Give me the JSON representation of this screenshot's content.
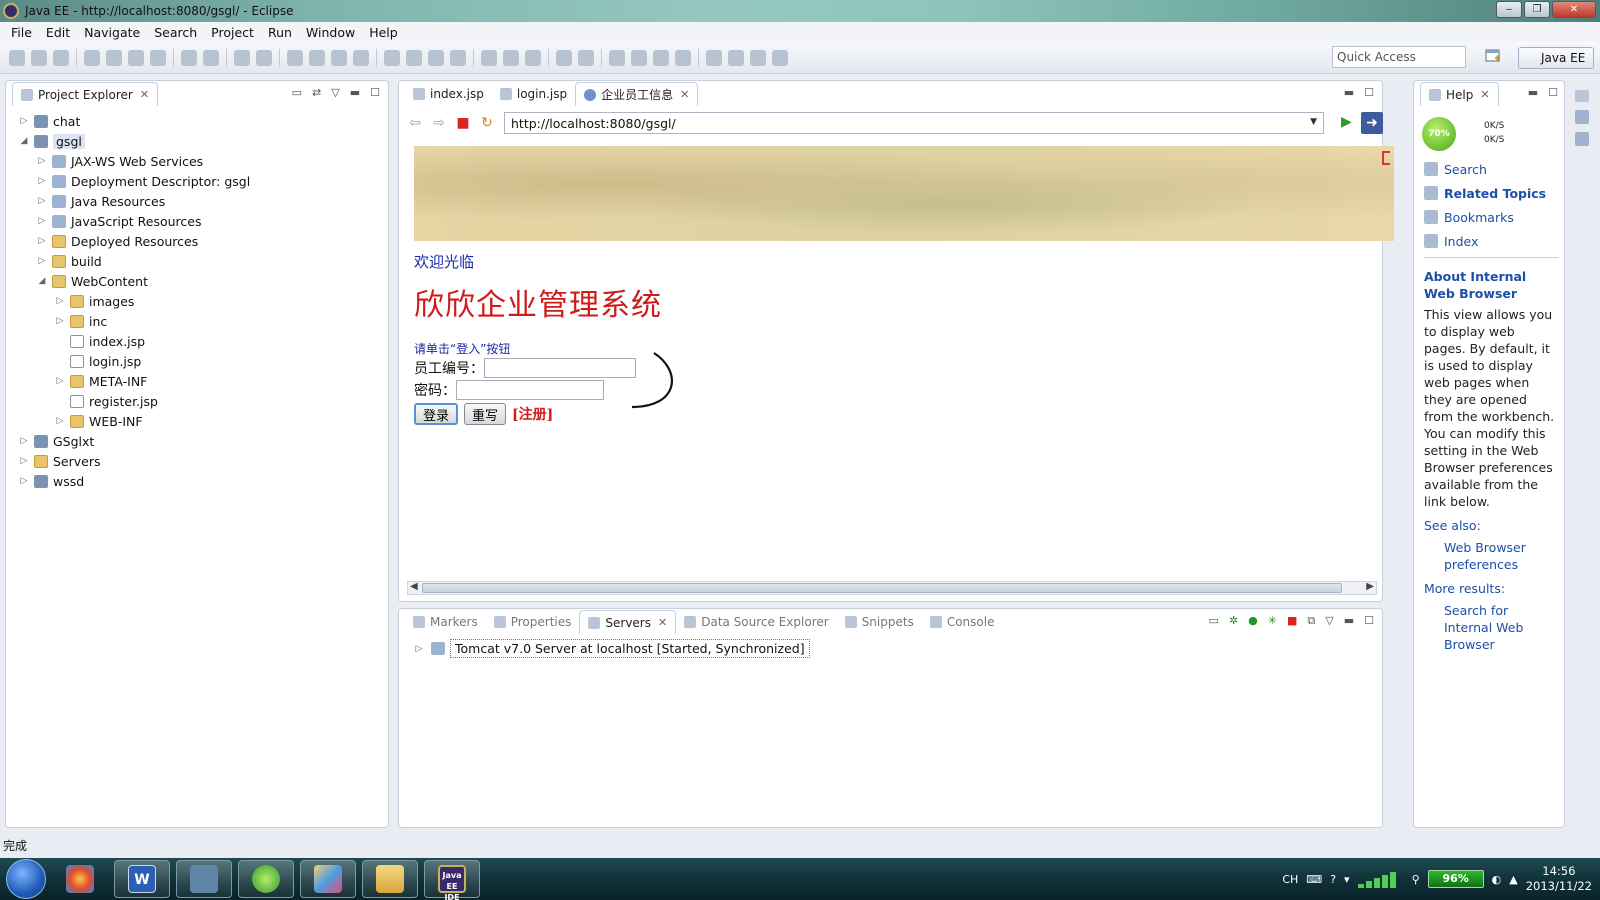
{
  "window": {
    "title": "Java EE - http://localhost:8080/gsgl/ - Eclipse",
    "minimize": "‒",
    "restore": "❐",
    "close": "✕"
  },
  "menu": [
    "File",
    "Edit",
    "Navigate",
    "Search",
    "Project",
    "Run",
    "Window",
    "Help"
  ],
  "toolbar": {
    "quick_access_placeholder": "Quick Access",
    "perspective": "Java EE"
  },
  "project_explorer": {
    "title": "Project Explorer",
    "items": [
      {
        "label": "chat",
        "level": 0,
        "expanded": false,
        "icon": "project-icon"
      },
      {
        "label": "gsgl",
        "level": 0,
        "expanded": true,
        "icon": "project-icon",
        "selected": true
      },
      {
        "label": "JAX-WS Web Services",
        "level": 1,
        "expanded": false,
        "icon": "webservice-icon"
      },
      {
        "label": "Deployment Descriptor: gsgl",
        "level": 1,
        "expanded": false,
        "icon": "descriptor-icon"
      },
      {
        "label": "Java Resources",
        "level": 1,
        "expanded": false,
        "icon": "java-resources-icon"
      },
      {
        "label": "JavaScript Resources",
        "level": 1,
        "expanded": false,
        "icon": "javascript-resources-icon"
      },
      {
        "label": "Deployed Resources",
        "level": 1,
        "expanded": false,
        "icon": "folder-icon"
      },
      {
        "label": "build",
        "level": 1,
        "expanded": false,
        "icon": "folder-icon"
      },
      {
        "label": "WebContent",
        "level": 1,
        "expanded": true,
        "icon": "folder-icon"
      },
      {
        "label": "images",
        "level": 2,
        "expanded": false,
        "icon": "folder-icon"
      },
      {
        "label": "inc",
        "level": 2,
        "expanded": false,
        "icon": "folder-icon"
      },
      {
        "label": "index.jsp",
        "level": 2,
        "leaf": true,
        "icon": "jsp-file-icon"
      },
      {
        "label": "login.jsp",
        "level": 2,
        "leaf": true,
        "icon": "jsp-file-icon"
      },
      {
        "label": "META-INF",
        "level": 2,
        "expanded": false,
        "icon": "folder-icon"
      },
      {
        "label": "register.jsp",
        "level": 2,
        "leaf": true,
        "icon": "jsp-file-icon"
      },
      {
        "label": "WEB-INF",
        "level": 2,
        "expanded": false,
        "icon": "folder-icon"
      },
      {
        "label": "GSglxt",
        "level": 0,
        "expanded": false,
        "icon": "project-icon"
      },
      {
        "label": "Servers",
        "level": 0,
        "expanded": false,
        "icon": "folder-icon"
      },
      {
        "label": "wssd",
        "level": 0,
        "expanded": false,
        "icon": "project-icon"
      }
    ]
  },
  "editor": {
    "tabs": [
      {
        "label": "index.jsp",
        "active": false
      },
      {
        "label": "login.jsp",
        "active": false
      },
      {
        "label": "企业员工信息",
        "active": true
      }
    ],
    "url": "http://localhost:8080/gsgl/",
    "page": {
      "welcome": "欢迎光临",
      "title": "欣欣企业管理系统",
      "hint": "请单击“登入”按钮",
      "employee_id_label": "员工编号：",
      "password_label": "密码：",
      "login_button": "登录",
      "reset_button": "重写",
      "register_link": "[注册]"
    }
  },
  "servers_view": {
    "tabs": [
      {
        "label": "Markers",
        "active": false
      },
      {
        "label": "Properties",
        "active": false
      },
      {
        "label": "Servers",
        "active": true
      },
      {
        "label": "Data Source Explorer",
        "active": false
      },
      {
        "label": "Snippets",
        "active": false
      },
      {
        "label": "Console",
        "active": false
      }
    ],
    "server": "Tomcat v7.0 Server at localhost  [Started, Synchronized]"
  },
  "help": {
    "title": "Help",
    "meter": {
      "percent": "70%",
      "up": "0K/S",
      "down": "0K/S"
    },
    "links": [
      {
        "label": "Search",
        "bold": false
      },
      {
        "label": "Related Topics",
        "bold": true
      },
      {
        "label": "Bookmarks",
        "bold": false
      },
      {
        "label": "Index",
        "bold": false
      }
    ],
    "heading": "About Internal Web Browser",
    "body": "This view allows you to display web pages. By default, it is used to display web pages when they are opened from the workbench. You can modify this setting in the Web Browser preferences available from the link below.",
    "see_also": "See also:",
    "see_also_link": "Web Browser preferences",
    "more_results": "More results:",
    "more_link": "Search for Internal Web Browser"
  },
  "status": {
    "text": "完成"
  },
  "taskbar": {
    "apps": [
      "start-button",
      "paint-icon",
      "word-icon",
      "network-app-icon",
      "browser-icon",
      "paint-brush-icon",
      "explorer-icon",
      "eclipse-icon"
    ],
    "word_glyph": "W",
    "eclipse_glyph": "Java EE IDE",
    "lang": "CH",
    "battery": "96%",
    "time": "14:56",
    "date": "2013/11/22"
  }
}
